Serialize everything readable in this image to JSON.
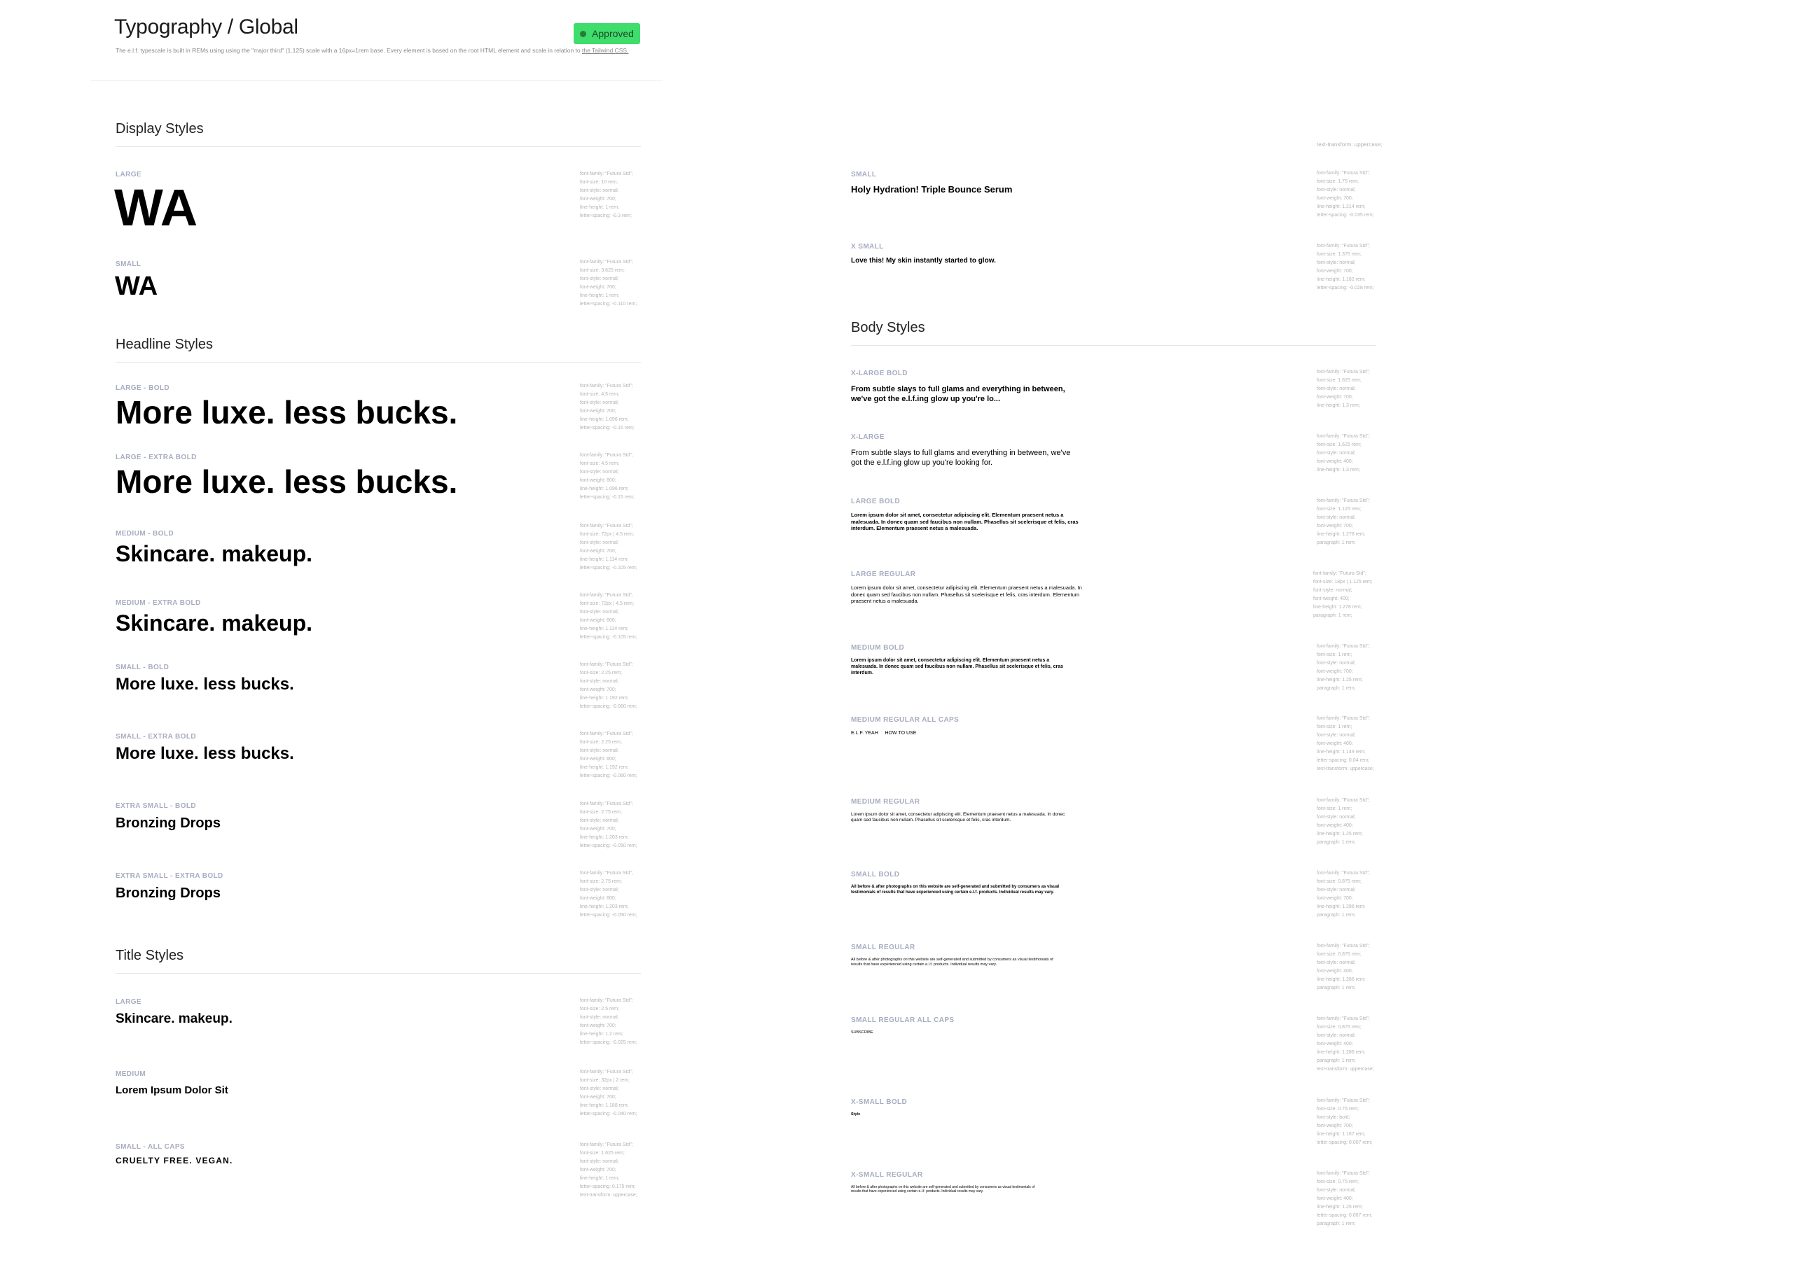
{
  "header": {
    "title": "Typography / Global",
    "intro": "The e.l.f. typescale is built in REMs using using the \"major third\" (1.125) scale with a 16px=1rem base. Every element is based on the root HTML element and scale in relation to",
    "intro_link": "the Tailwind CSS.",
    "badge": "Approved",
    "accent_color": "#3fdd6b"
  },
  "right_column_top_marker": "text-transform: uppercase;",
  "sections": {
    "display": "Display Styles",
    "headline": "Headline Styles",
    "title": "Title Styles",
    "body": "Body Styles"
  },
  "styles": {
    "display_large": {
      "label": "LARGE",
      "sample": "WA",
      "specs": [
        "font-family: \"Futura Std\";",
        "font-size: 10 rem;",
        "font-style: normal;",
        "font-weight: 700;",
        "line-height: 1 rem;",
        "letter-spacing: -0.3 rem;"
      ]
    },
    "display_small": {
      "label": "SMALL",
      "sample": "WA",
      "specs": [
        "font-family: \"Futura Std\";",
        "font-size: 3.625 rem;",
        "font-style: normal;",
        "font-weight: 700;",
        "line-height: 1 rem;",
        "letter-spacing: -0.110 rem;"
      ]
    },
    "headline_large_bold": {
      "label": "LARGE - BOLD",
      "sample": "More luxe. less bucks.",
      "specs": [
        "font-family: \"Futura Std\";",
        "font-size: 4.5 rem;",
        "font-style: normal;",
        "font-weight: 700;",
        "line-height: 1.096 rem;",
        "letter-spacing: -0.15 rem;"
      ]
    },
    "headline_large_extra_bold": {
      "label": "LARGE - EXTRA BOLD",
      "sample": "More luxe. less bucks.",
      "specs": [
        "font-family: \"Futura Std\";",
        "font-size: 4.5 rem;",
        "font-style: normal;",
        "font-weight: 800;",
        "line-height: 1.096 rem;",
        "letter-spacing: -0.15 rem;"
      ]
    },
    "headline_medium_bold": {
      "label": "MEDIUM - BOLD",
      "sample": "Skincare. makeup.",
      "specs": [
        "font-family: \"Futura Std\";",
        "font-size: 72px | 4.5 rem;",
        "font-style: normal;",
        "font-weight: 700;",
        "line-height: 1.114 rem;",
        "letter-spacing: -0.105 rem;"
      ]
    },
    "headline_medium_extra_bold": {
      "label": "MEDIUM - EXTRA BOLD",
      "sample": "Skincare. makeup.",
      "specs": [
        "font-family: \"Futura Std\";",
        "font-size: 72px | 4.5 rem;",
        "font-style: normal;",
        "font-weight: 800;",
        "line-height: 1.114 rem;",
        "letter-spacing: -0.105 rem;"
      ]
    },
    "headline_small_bold": {
      "label": "SMALL - BOLD",
      "sample": "More luxe. less bucks.",
      "specs": [
        "font-family: \"Futura Std\";",
        "font-size: 2.25 rem;",
        "font-style: normal;",
        "font-weight: 700;",
        "line-height: 1.192 rem;",
        "letter-spacing: -0.060 rem;"
      ]
    },
    "headline_small_extra_bold": {
      "label": "SMALL - EXTRA BOLD",
      "sample": "More luxe. less bucks.",
      "specs": [
        "font-family: \"Futura Std\";",
        "font-size: 2.25 rem;",
        "font-style: normal;",
        "font-weight: 800;",
        "line-height: 1.192 rem;",
        "letter-spacing: -0.060 rem;"
      ]
    },
    "headline_xsmall_bold": {
      "label": "EXTRA SMALL - BOLD",
      "sample": "Bronzing Drops",
      "specs": [
        "font-family: \"Futura Std\";",
        "font-size: 2.75 rem;",
        "font-style: normal;",
        "font-weight: 700;",
        "line-height: 1.203 rem;",
        "letter-spacing: -0.050 rem;"
      ]
    },
    "headline_xsmall_extra_bold": {
      "label": "EXTRA SMALL - EXTRA BOLD",
      "sample": "Bronzing Drops",
      "specs": [
        "font-family: \"Futura Std\";",
        "font-size: 2.75 rem;",
        "font-style: normal;",
        "font-weight: 800;",
        "line-height: 1.203 rem;",
        "letter-spacing: -0.050 rem;"
      ]
    },
    "title_large": {
      "label": "LARGE",
      "sample": "Skincare. makeup.",
      "specs": [
        "font-family: \"Futura Std\";",
        "font-size: 2.5 rem;",
        "font-style: normal;",
        "font-weight: 700;",
        "line-height: 1.2 rem;",
        "letter-spacing: -0.025 rem;"
      ]
    },
    "title_medium": {
      "label": "MEDIUM",
      "sample": "Lorem Ipsum Dolor Sit",
      "specs": [
        "font-family: \"Futura Std\";",
        "font-size: 32px | 2 rem;",
        "font-style: normal;",
        "font-weight: 700;",
        "line-height: 1.188 rem;",
        "letter-spacing: -0.040 rem;"
      ]
    },
    "title_small_caps": {
      "label": "SMALL - ALL CAPS",
      "sample": "CRUELTY FREE. VEGAN.",
      "specs": [
        "font-family: \"Futura Std\";",
        "font-size: 1.625 rem;",
        "font-style: normal;",
        "font-weight: 700;",
        "line-height: 1 rem;",
        "letter-spacing: 0.175 rem;",
        "text-transform: uppercase;"
      ]
    },
    "title_r_small": {
      "label": "SMALL",
      "sample": "Holy Hydration! Triple Bounce Serum",
      "specs": [
        "font-family: \"Futura Std\";",
        "font-size: 1.75 rem;",
        "font-style: normal;",
        "font-weight: 700;",
        "line-height: 1.214 rem;",
        "letter-spacing: -0.035 rem;"
      ]
    },
    "title_r_xsmall": {
      "label": "X SMALL",
      "sample": "Love this! My skin instantly started to glow.",
      "specs": [
        "font-family: \"Futura Std\";",
        "font-size: 1.375 rem;",
        "font-style: normal;",
        "font-weight: 700;",
        "line-height: 1.182 rem;",
        "letter-spacing: -0.028 rem;"
      ]
    },
    "body_xl_bold": {
      "label": "X-LARGE BOLD",
      "sample": "From subtle slays to full glams and everything in between, we've got the e.l.f.ing glow up you're lo...",
      "specs": [
        "font-family: \"Futura Std\";",
        "font-size: 1.625 rem;",
        "font-style: normal;",
        "font-weight: 700;",
        "line-height: 1.3 rem;"
      ]
    },
    "body_xl": {
      "label": "X-LARGE",
      "sample": "From subtle slays to full glams and everything in between, we've got the e.l.f.ing glow up you're looking for.",
      "specs": [
        "font-family: \"Futura Std\";",
        "font-size: 1.625 rem;",
        "font-style: normal;",
        "font-weight: 400;",
        "line-height: 1.3 rem;"
      ]
    },
    "body_l_bold": {
      "label": "LARGE BOLD",
      "sample": "Lorem ipsum dolor sit amet, consectetur adipiscing elit. Elementum praesent netus a malesuada. In donec quam sed faucibus non nullam. Phasellus sit scelerisque et felis, cras interdum. Elementum praesent netus a malesuada.",
      "specs": [
        "font-family: \"Futura Std\";",
        "font-size: 1.125 rem;",
        "font-style: normal;",
        "font-weight: 700;",
        "line-height: 1.278 rem;",
        "paragraph: 1 rem;"
      ]
    },
    "body_l_reg": {
      "label": "LARGE REGULAR",
      "sample": "Lorem ipsum dolor sit amet, consectetur adipiscing elit. Elementum praesent netus a malesuada. In donec quam sed faucibus non nullam. Phasellus sit scelerisque et felis, cras interdum. Elementum praesent netus a malesuada.",
      "specs": [
        "font-family: \"Futura Std\";",
        "font-size: 18px | 1.125 rem;",
        "font-style: normal;",
        "font-weight: 400;",
        "line-height: 1.278 rem;",
        "paragraph: 1 rem;"
      ]
    },
    "body_m_bold": {
      "label": "MEDIUM BOLD",
      "sample": "Lorem ipsum dolor sit amet, consectetur adipiscing elit. Elementum praesent netus a malesuada. In donec quam sed faucibus non nullam. Phasellus sit scelerisque et felis, cras interdum.",
      "specs": [
        "font-family: \"Futura Std\";",
        "font-size: 1 rem;",
        "font-style: normal;",
        "font-weight: 700;",
        "line-height: 1.25 rem;",
        "paragraph: 1 rem;"
      ]
    },
    "body_m_caps": {
      "label": "MEDIUM REGULAR ALL CAPS",
      "sample": "E.L.F. YEAH     HOW TO USE",
      "specs": [
        "font-family: \"Futura Std\";",
        "font-size: 1 rem;",
        "font-style: normal;",
        "font-weight: 400;",
        "line-height: 1.149 rem;",
        "letter-spacing: 0.04 rem;",
        "text-transform: uppercase;"
      ]
    },
    "body_m_reg": {
      "label": "MEDIUM REGULAR",
      "sample": "Lorem ipsum dolor sit amet, consectetur adipiscing elit. Elementum praesent netus a malesuada. In donec quam sed faucibus non nullam. Phasellus sit scelerisque et felis, cras interdum.",
      "specs": [
        "font-family: \"Futura Std\";",
        "font-size: 1 rem;",
        "font-style: normal;",
        "font-weight: 400;",
        "line-height: 1.25 rem;",
        "paragraph: 1 rem;"
      ]
    },
    "body_s_bold": {
      "label": "SMALL BOLD",
      "sample": "All before & after photographs on this website are self-generated and submitted by consumers as visual testimonials of results that have experienced using certain e.l.f. products. Individual results may vary.",
      "specs": [
        "font-family: \"Futura Std\";",
        "font-size: 0.875 rem;",
        "font-style: normal;",
        "font-weight: 700;",
        "line-height: 1.286 rem;",
        "paragraph: 1 rem;"
      ]
    },
    "body_s_reg": {
      "label": "SMALL REGULAR",
      "sample": "All before & after photographs on this website are self-generated and submitted by consumers as visual testimonials of results that have experienced using certain e.l.f. products. Individual results may vary.",
      "specs": [
        "font-family: \"Futura Std\";",
        "font-size: 0.875 rem;",
        "font-style: normal;",
        "font-weight: 400;",
        "line-height: 1.286 rem;",
        "paragraph: 1 rem;"
      ]
    },
    "body_s_caps": {
      "label": "SMALL REGULAR ALL CAPS",
      "sample": "SUBSCRIBE",
      "specs": [
        "font-family: \"Futura Std\";",
        "font-size: 0.875 rem;",
        "font-style: normal;",
        "font-weight: 400;",
        "line-height: 1.286 rem;",
        "paragraph: 1 rem;",
        "text-transform: uppercase;"
      ]
    },
    "body_xs_bold": {
      "label": "X-SMALL BOLD",
      "sample": "Style",
      "specs": [
        "font-family: \"Futura Std\";",
        "font-size: 0.75 rem;",
        "font-style: bold;",
        "font-weight: 700;",
        "line-height: 1.167 rem;",
        "letter-spacing: 0.007 rem;"
      ]
    },
    "body_xs_reg": {
      "label": "X-SMALL REGULAR",
      "sample": "All before & after photographs on this website are self-generated and submitted by consumers as visual testimonials of results that have experienced using certain e.l.f. products. Individual results may vary.",
      "specs": [
        "font-family: \"Futura Std\";",
        "font-size: 0.75 rem;",
        "font-style: normal;",
        "font-weight: 400;",
        "line-height: 1.25 rem;",
        "letter-spacing: 0.007 rem;",
        "paragraph: 1 rem;"
      ]
    }
  }
}
